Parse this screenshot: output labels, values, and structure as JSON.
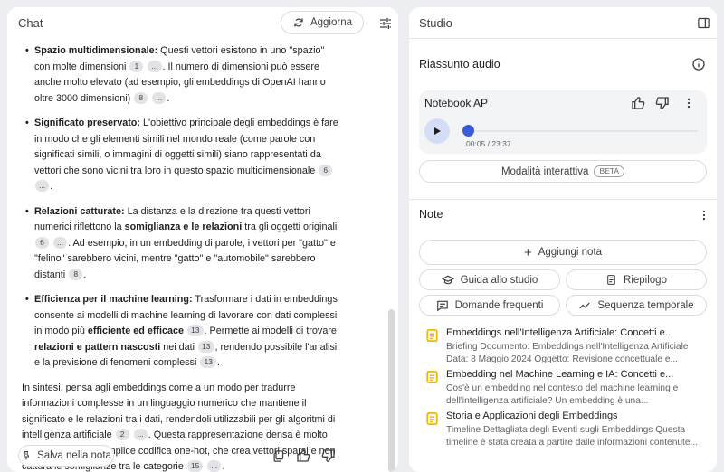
{
  "chat": {
    "title": "Chat",
    "refresh_label": "Aggiorna",
    "bullets": [
      {
        "bold": "Spazio multidimensionale:",
        "parts": [
          " Questi vettori esistono in uno \"spazio\" con molte dimensioni ",
          {
            "cite": "1"
          },
          " ",
          {
            "cite": "..."
          },
          ". Il numero di dimensioni può essere anche molto elevato (ad esempio, gli embeddings di OpenAI hanno oltre 3000 dimensioni) ",
          {
            "cite": "8"
          },
          " ",
          {
            "cite": "..."
          },
          "."
        ]
      },
      {
        "bold": "Significato preservato:",
        "parts": [
          " L'obiettivo principale degli embeddings è fare in modo che gli elementi simili nel mondo reale (come parole con significati simili, o immagini di oggetti simili) siano rappresentati da vettori che sono vicini tra loro in questo spazio multidimensionale ",
          {
            "cite": "6"
          },
          " ",
          {
            "cite": "..."
          },
          "."
        ]
      },
      {
        "bold": "Relazioni catturate:",
        "parts": [
          " La distanza e la direzione tra questi vettori numerici riflettono la ",
          {
            "b": "somiglianza e le relazioni"
          },
          " tra gli oggetti originali ",
          {
            "cite": "6"
          },
          " ",
          {
            "cite": "..."
          },
          ". Ad esempio, in un embedding di parole, i vettori per \"gatto\" e \"felino\" sarebbero vicini, mentre \"gatto\" e \"automobile\" sarebbero distanti ",
          {
            "cite": "8"
          },
          "."
        ]
      },
      {
        "bold": "Efficienza per il machine learning:",
        "parts": [
          " Trasformare i dati in embeddings consente ai modelli di machine learning di lavorare con dati complessi in modo più ",
          {
            "b": "efficiente ed efficace"
          },
          " ",
          {
            "cite": "13"
          },
          ". Permette ai modelli di trovare ",
          {
            "b": "relazioni e pattern nascosti"
          },
          " nei dati ",
          {
            "cite": "13"
          },
          ", rendendo possibile l'analisi e la previsione di fenomeni complessi ",
          {
            "cite": "13"
          },
          "."
        ]
      }
    ],
    "summary_parts": [
      "In sintesi, pensa agli embeddings come a un modo per tradurre informazioni complesse in un linguaggio numerico che mantiene il significato e le relazioni tra i dati, rendendoli utilizzabili per gli algoritmi di intelligenza artificiale ",
      {
        "cite": "2"
      },
      " ",
      {
        "cite": "..."
      },
      ". Questa rappresentazione densa è molto più efficace della semplice codifica one-hot, che crea vettori sparsi e non cattura le somiglianze tra le categorie ",
      {
        "cite": "15"
      },
      " ",
      {
        "cite": "..."
      },
      "."
    ],
    "save_note_label": "Salva nella nota"
  },
  "studio": {
    "title": "Studio",
    "audio_section_title": "Riassunto audio",
    "audio_card": {
      "title": "Notebook AP",
      "time": "00:05 / 23:37",
      "progress": 0.0035
    },
    "interactive_label": "Modalità interattiva",
    "beta_label": "BETA",
    "notes_title": "Note",
    "add_note_label": "Aggiungi nota",
    "grid_buttons": [
      {
        "label": "Guida allo studio",
        "icon": "graduation-cap-icon"
      },
      {
        "label": "Riepilogo",
        "icon": "document-summary-icon"
      },
      {
        "label": "Domande frequenti",
        "icon": "faq-icon"
      },
      {
        "label": "Sequenza temporale",
        "icon": "timeline-icon"
      }
    ],
    "notes": [
      {
        "title": "Embeddings nell'Intelligenza Artificiale: Concetti e...",
        "line1": "Briefing Documento: Embeddings nell'Intelligenza Artificiale",
        "line2": "Data: 8 Maggio 2024 Oggetto: Revisione concettuale e..."
      },
      {
        "title": "Embedding nel Machine Learning e IA: Concetti e...",
        "line1": "Cos'è un embedding nel contesto del machine learning e",
        "line2": "dell'intelligenza artificiale? Un embedding è una..."
      },
      {
        "title": "Storia e Applicazioni degli Embeddings",
        "line1": "Timeline Dettagliata degli Eventi sugli Embeddings Questa",
        "line2": "timeline è stata creata a partire dalle informazioni contenute..."
      }
    ],
    "accent_color": "#3a5bd9",
    "note_icon_color": "#f2b700"
  }
}
